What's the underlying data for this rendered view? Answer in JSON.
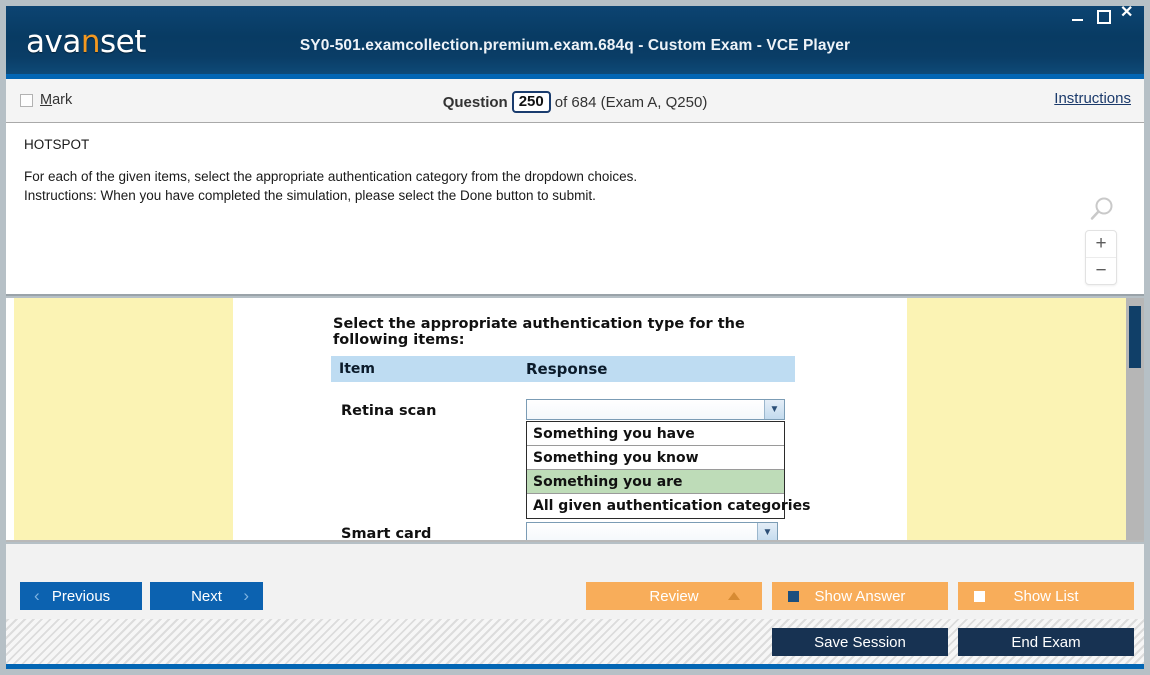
{
  "window": {
    "logo_text_a": "ava",
    "logo_text_accent": "n",
    "logo_text_b": "set",
    "title": "SY0-501.examcollection.premium.exam.684q - Custom Exam - VCE Player",
    "controls": {
      "minimize": "minimize-icon",
      "maximize": "maximize-icon",
      "close": "close-icon"
    }
  },
  "question_bar": {
    "mark_label_accel": "M",
    "mark_label_rest": "ark",
    "question_word": "Question",
    "question_number": "250",
    "of_text": "of 684 (Exam A, Q250)",
    "instructions_link": "Instructions"
  },
  "question_panel": {
    "type_tag": "HOTSPOT",
    "line1": "For each of the given items, select the appropriate authentication category from the dropdown choices.",
    "line2": "Instructions: When you have completed the simulation, please select the Done button to submit.",
    "zoom_in": "+",
    "zoom_out": "−"
  },
  "exhibit": {
    "heading": "Select the appropriate authentication type for the following items:",
    "columns": {
      "item": "Item",
      "response": "Response"
    },
    "rows": [
      {
        "label": "Retina scan",
        "value": "",
        "open": true
      },
      {
        "label": "Smart card",
        "value": "",
        "open": false
      }
    ],
    "dropdown_options": [
      {
        "label": "Something you have",
        "selected": false
      },
      {
        "label": "Something you know",
        "selected": false
      },
      {
        "label": "Something you are",
        "selected": true
      },
      {
        "label": "All given authentication categories",
        "selected": false
      }
    ]
  },
  "nav_bar": {
    "previous": "Previous",
    "next": "Next",
    "review": "Review",
    "show_answer": "Show Answer",
    "show_list": "Show List",
    "prev_chevron": "‹",
    "next_chevron": "›"
  },
  "bottom_bar": {
    "save_session": "Save Session",
    "end_exam": "End Exam"
  },
  "colors": {
    "header_navy": "#083b63",
    "accent_blue": "#0366b4",
    "nav_blue": "#0c62b0",
    "orange": "#f8ad5a",
    "dark_navy_button": "#173252",
    "exhibit_yellow": "#fbf3b4",
    "table_header_blue": "#bedcf2",
    "option_selected_green": "#bedcb8",
    "logo_accent_orange": "#f39921"
  }
}
